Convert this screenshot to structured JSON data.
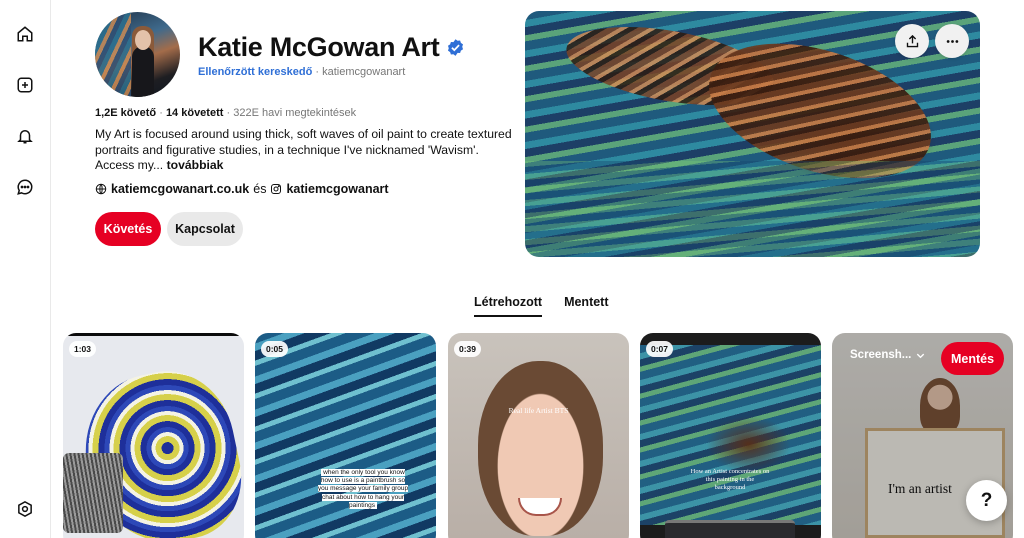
{
  "nav": {
    "items": [
      {
        "icon": "home-icon"
      },
      {
        "icon": "create-icon"
      },
      {
        "icon": "notifications-icon"
      },
      {
        "icon": "messages-icon"
      }
    ],
    "settings_icon": "settings-icon"
  },
  "profile": {
    "name": "Katie McGowan Art",
    "verified_merchant": "Ellenőrzött kereskedő",
    "separator": "·",
    "username": "katiemcgowanart",
    "followers": "1,2E követő",
    "following": "14 követett",
    "monthly_views": "322E havi megtekintések",
    "bio": "My Art is focused around using thick, soft waves of oil paint to create textured portraits and figurative studies, in a technique I've nicknamed 'Wavism'. Access my...",
    "bio_more": "továbbiak",
    "website": "katiemcgowanart.co.uk",
    "and": "és",
    "instagram": "katiemcgowanart",
    "follow_button": "Követés",
    "contact_button": "Kapcsolat"
  },
  "tabs": {
    "created": "Létrehozott",
    "saved": "Mentett",
    "active": "created"
  },
  "pins": [
    {
      "duration": "1:03"
    },
    {
      "duration": "0:05",
      "caption": "when the only tool you know how to use is a paintbrush so you message your family group chat about how to hang your paintings"
    },
    {
      "duration": "0:39",
      "caption": "Real life Artist BTS"
    },
    {
      "duration": "0:07",
      "caption": "How an Artist concentrates on this painting in the background"
    },
    {
      "board": "Screensh...",
      "save": "Mentés",
      "caption": "I'm an artist"
    }
  ],
  "help_button": "?",
  "colors": {
    "accent": "#e60023",
    "verified": "#2f6fd6",
    "muted_text": "#767676",
    "secondary_button": "#e9e9e9"
  }
}
